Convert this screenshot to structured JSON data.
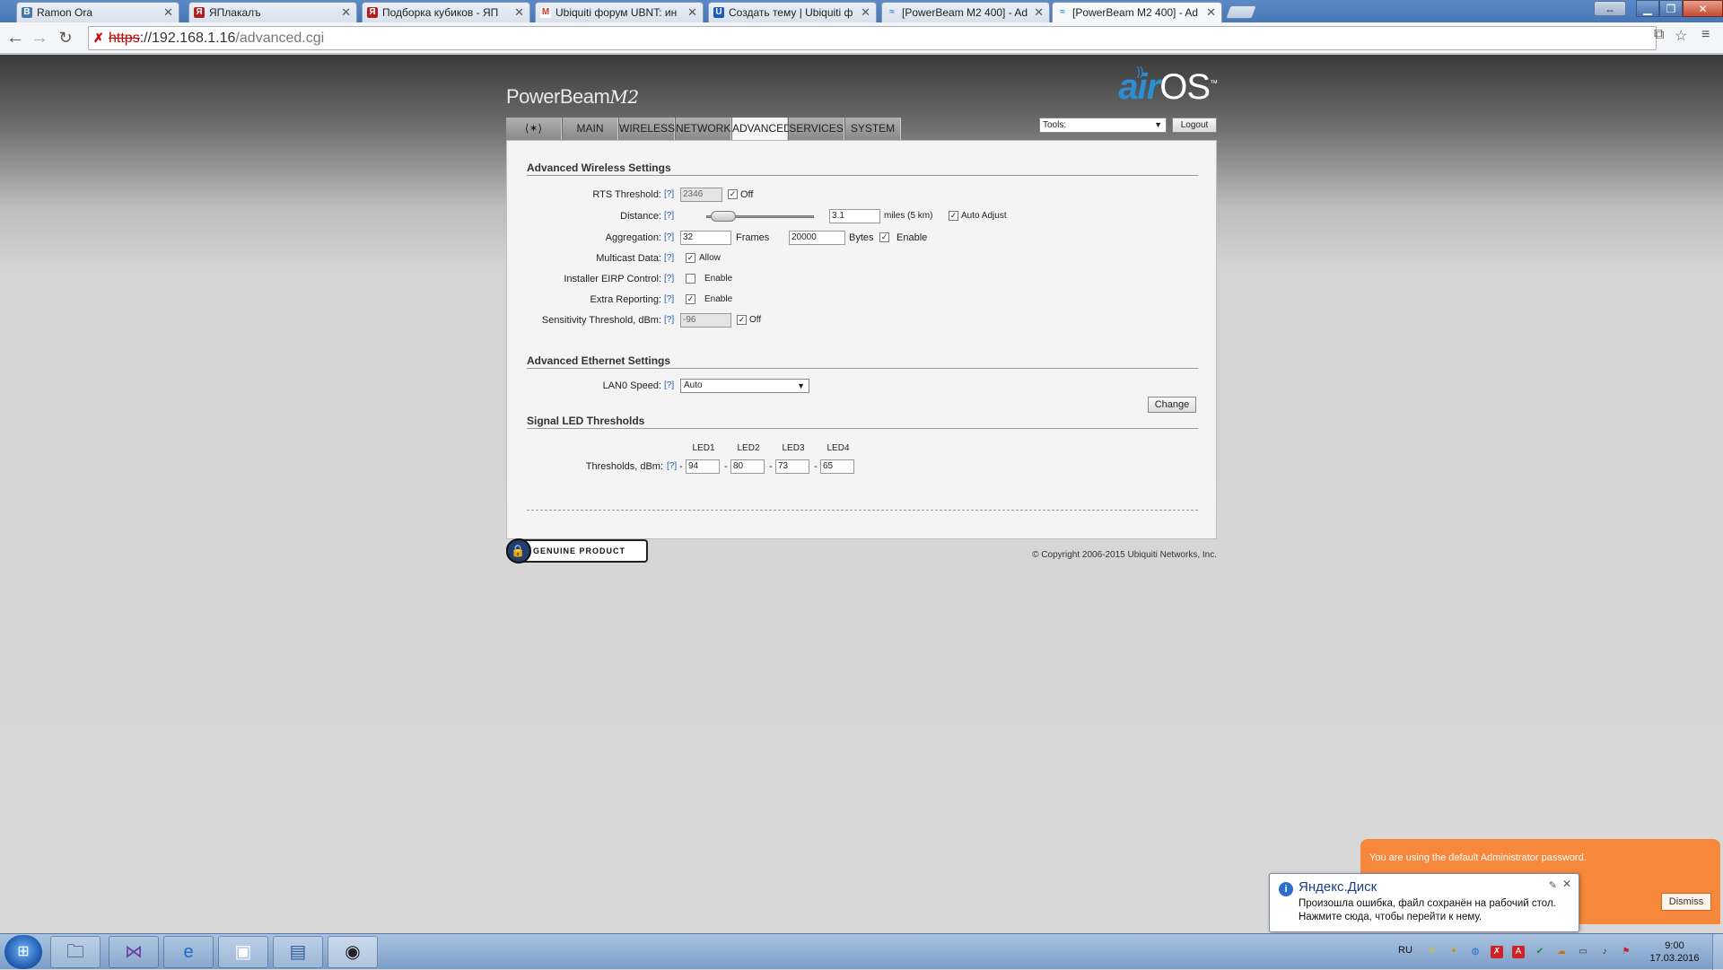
{
  "browser": {
    "tabs": [
      {
        "label": "Ramon Ora",
        "favicon": "В",
        "favicon_color": "#4a76a8"
      },
      {
        "label": "ЯПлакалъ",
        "favicon": "Я",
        "favicon_color": "#b02020"
      },
      {
        "label": "Подборка кубиков - ЯП",
        "favicon": "Я",
        "favicon_color": "#b02020"
      },
      {
        "label": "Ubiquiti форум UBNT: ин",
        "favicon": "M",
        "favicon_color": "#d93025"
      },
      {
        "label": "Создать тему | Ubiquiti ф",
        "favicon": "U",
        "favicon_color": "#1d5bb8"
      },
      {
        "label": "[PowerBeam M2 400] - Ad",
        "favicon": "≈",
        "favicon_color": "#2a8fd4"
      },
      {
        "label": "[PowerBeam M2 400] - Ad",
        "favicon": "≈",
        "favicon_color": "#2a8fd4"
      }
    ],
    "active_tab_index": 6,
    "url": {
      "proto": "https",
      "host": "://192.168.1.16",
      "path": "/advanced.cgi"
    }
  },
  "device": {
    "brand": "PowerBeam",
    "model": "M2",
    "logo_air": "air",
    "logo_os": "OS",
    "logo_tm": "™"
  },
  "nav": {
    "tabs": [
      "MAIN",
      "WIRELESS",
      "NETWORK",
      "ADVANCED",
      "SERVICES",
      "SYSTEM"
    ],
    "active": "ADVANCED",
    "tools_label": "Tools:",
    "logout_label": "Logout"
  },
  "wireless": {
    "title": "Advanced Wireless Settings",
    "help": "[?]",
    "rts": {
      "label": "RTS Threshold:",
      "value": "2346",
      "off_checked": true,
      "off_label": "Off"
    },
    "distance": {
      "label": "Distance:",
      "value": "3.1",
      "unit": "miles (5 km)",
      "auto_checked": true,
      "auto_label": "Auto Adjust",
      "slider_fraction": 0.05
    },
    "aggregation": {
      "label": "Aggregation:",
      "frames": "32",
      "frames_label": "Frames",
      "bytes": "20000",
      "bytes_label": "Bytes",
      "enable_checked": true,
      "enable_label": "Enable"
    },
    "multicast": {
      "label": "Multicast Data:",
      "checked": true,
      "opt_label": "Allow"
    },
    "eirp": {
      "label": "Installer EIRP Control:",
      "checked": false,
      "opt_label": "Enable"
    },
    "extra": {
      "label": "Extra Reporting:",
      "checked": true,
      "opt_label": "Enable"
    },
    "sensitivity": {
      "label": "Sensitivity Threshold, dBm:",
      "value": "-96",
      "off_checked": true,
      "off_label": "Off"
    }
  },
  "ethernet": {
    "title": "Advanced Ethernet Settings",
    "lan0": {
      "label": "LAN0 Speed:",
      "value": "Auto"
    }
  },
  "led": {
    "title": "Signal LED Thresholds",
    "row_label": "Thresholds, dBm:",
    "headers": [
      "LED1",
      "LED2",
      "LED3",
      "LED4"
    ],
    "values": [
      "94",
      "80",
      "73",
      "65"
    ],
    "dash": "-"
  },
  "footer": {
    "change_label": "Change",
    "genuine_label": "GENUINE  PRODUCT",
    "copyright": "© Copyright 2006-2015 Ubiquiti Networks, Inc."
  },
  "notice": {
    "text": "You are using the default Administrator password.",
    "dismiss": "Dismiss"
  },
  "yadisk": {
    "title": "Яндекс.Диск",
    "line1": "Произошла ошибка, файл сохранён на рабочий стол.",
    "line2": "Нажмите сюда, чтобы перейти к нему."
  },
  "taskbar": {
    "lang": "RU",
    "time": "9:00",
    "date": "17.03.2016",
    "items": [
      "folder-icon",
      "visual-studio-icon",
      "internet-explorer-icon",
      "cmd-icon",
      "image-viewer-icon",
      "chrome-icon"
    ]
  }
}
